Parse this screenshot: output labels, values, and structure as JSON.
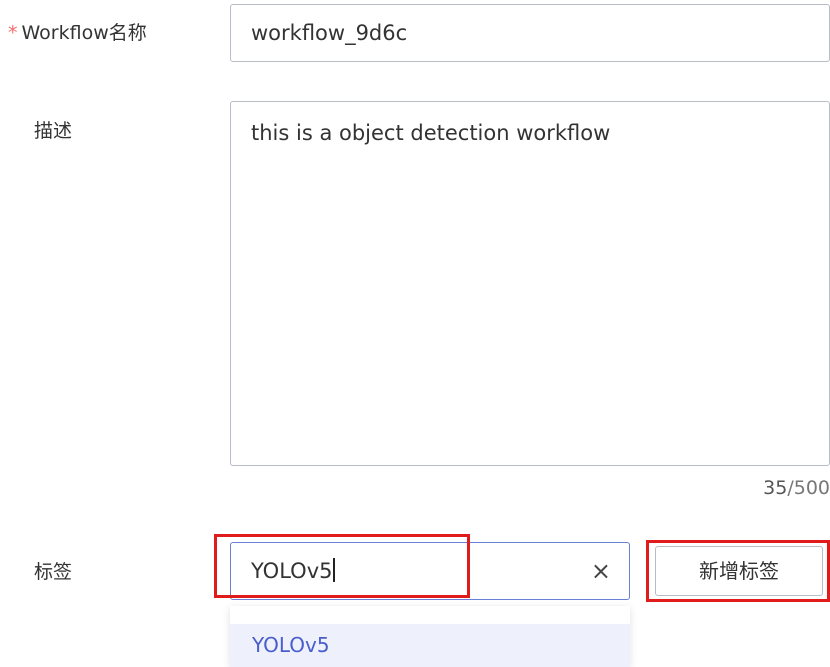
{
  "form": {
    "name": {
      "required_mark": "*",
      "label": "Workflow名称",
      "value": "workflow_9d6c"
    },
    "description": {
      "label": "描述",
      "value": "this is a object detection workflow",
      "count": "35",
      "max": "/500"
    },
    "tags": {
      "label": "标签",
      "input_value": "YOLOv5",
      "clear_icon": "×",
      "add_button": "新增标签",
      "dropdown_options": [
        "YOLOv5"
      ]
    }
  },
  "colors": {
    "required": "#f56c6c",
    "focus_border": "#6a7fd6",
    "highlight_red": "#e01b1b",
    "option_text": "#4a5ecb",
    "option_bg": "#eef1fb"
  }
}
